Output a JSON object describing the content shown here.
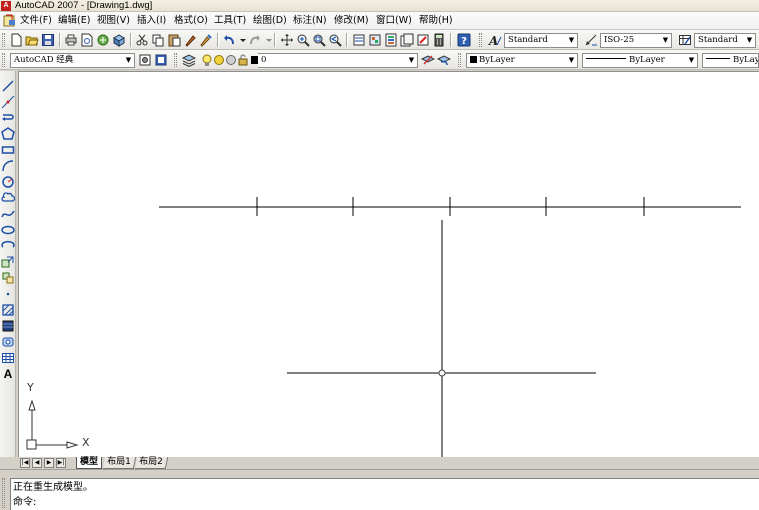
{
  "window": {
    "title": "AutoCAD 2007 - [Drawing1.dwg]",
    "app_icon_text": "A"
  },
  "menu": {
    "items": [
      {
        "label": "文件(F)"
      },
      {
        "label": "编辑(E)"
      },
      {
        "label": "视图(V)"
      },
      {
        "label": "插入(I)"
      },
      {
        "label": "格式(O)"
      },
      {
        "label": "工具(T)"
      },
      {
        "label": "绘图(D)"
      },
      {
        "label": "标注(N)"
      },
      {
        "label": "修改(M)"
      },
      {
        "label": "窗口(W)"
      },
      {
        "label": "帮助(H)"
      }
    ]
  },
  "toolbar_styles": {
    "text_style": "Standard",
    "dim_style": "ISO-25",
    "table_style": "Standard"
  },
  "toolbar_props": {
    "workspace": "AutoCAD 经典",
    "layer": "0",
    "color": "ByLayer",
    "linetype": "ByLayer",
    "lineweight": "ByLayer"
  },
  "left_tools": {
    "text_tool_glyph": "A"
  },
  "ucs": {
    "x_label": "X",
    "y_label": "Y"
  },
  "tabs": {
    "nav_first": "|◀",
    "nav_prev": "◀",
    "nav_next": "▶",
    "nav_last": "▶|",
    "model": "模型",
    "layout1": "布局1",
    "layout2": "布局2"
  },
  "command": {
    "history": "正在重生成模型。",
    "prompt": "命令:"
  },
  "colors": {
    "canvas_bg": "#ffffff",
    "drawing_lines": "#000000",
    "ui_face": "#d4d0c8"
  }
}
